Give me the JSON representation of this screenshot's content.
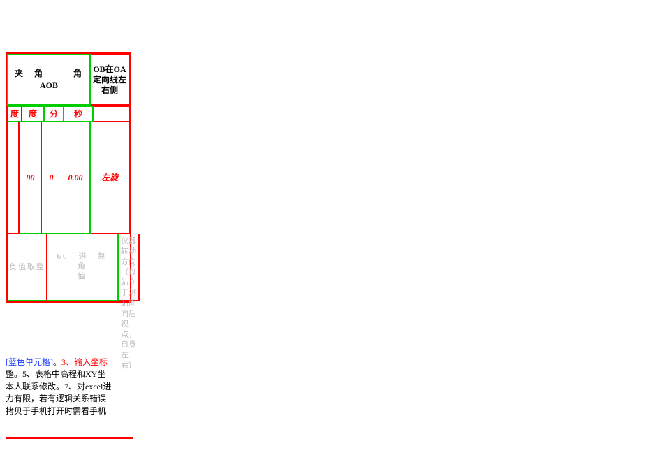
{
  "header": {
    "left_top": "夹　角　　　角",
    "left_sub": "AOB",
    "right": "OB在OA定向线左右侧"
  },
  "subheader": {
    "du1": "度",
    "du2": "度",
    "fen": "分",
    "miao": "秒"
  },
  "data": {
    "du1": "",
    "du2": "90",
    "fen": "0",
    "miao": "0.00",
    "side": "左旋"
  },
  "desc": {
    "left": "负值取整",
    "mid_top": "60　进　制　角",
    "mid_bottom": "值",
    "right": "仪器转动方向（以站立于测站面向后视点，自身左右）"
  },
  "notes": {
    "l1_blue": "[蓝色单元格]",
    "l1_tail": "。",
    "l1_red": "3、输入坐标",
    "l2": "整。5、表格中高程和XY坐",
    "l3": "本人联系修改。7、对excel进",
    "l4": "力有限，若有逻辑关系错误",
    "l5": "拷贝于手机打开时需看手机"
  }
}
